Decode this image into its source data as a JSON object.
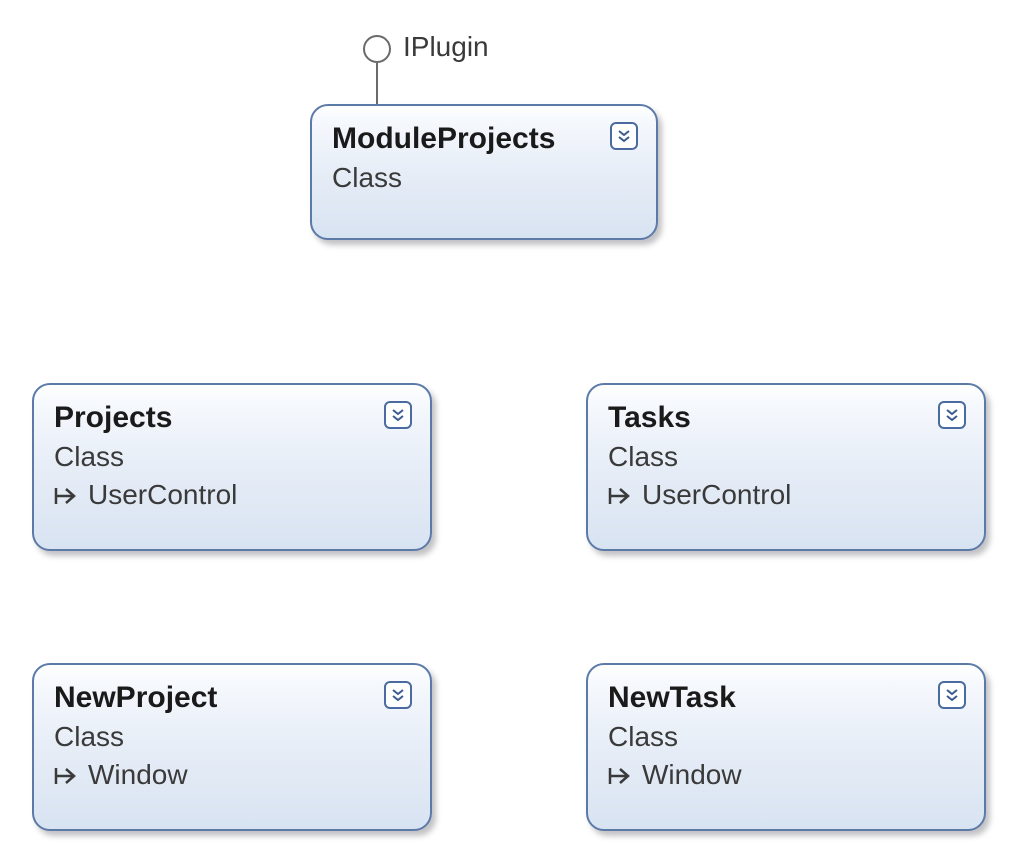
{
  "interface": {
    "name": "IPlugin"
  },
  "classes": {
    "moduleProjects": {
      "name": "ModuleProjects",
      "stereotype": "Class"
    },
    "projects": {
      "name": "Projects",
      "stereotype": "Class",
      "base": "UserControl"
    },
    "tasks": {
      "name": "Tasks",
      "stereotype": "Class",
      "base": "UserControl"
    },
    "newProject": {
      "name": "NewProject",
      "stereotype": "Class",
      "base": "Window"
    },
    "newTask": {
      "name": "NewTask",
      "stereotype": "Class",
      "base": "Window"
    }
  }
}
